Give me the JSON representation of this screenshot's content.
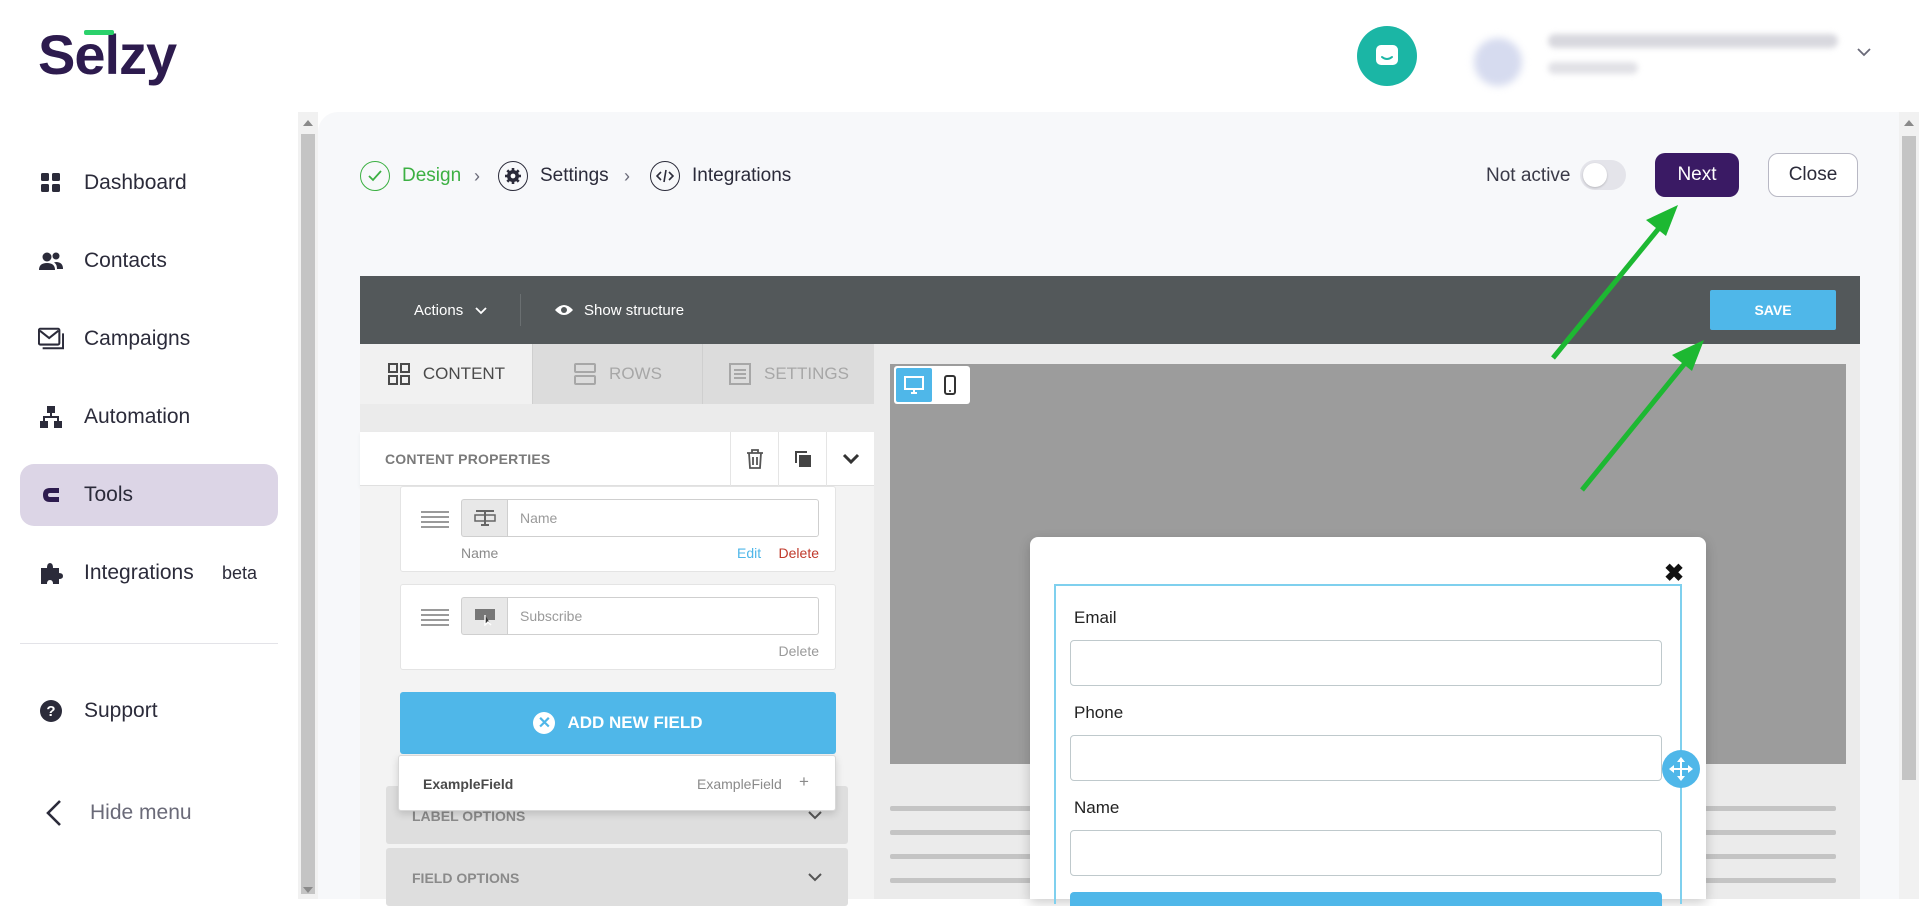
{
  "app": {
    "logo": "Selzy",
    "logo_accent": "#2bd16b",
    "brand_color": "#3a1a64"
  },
  "sidebar": {
    "items": [
      {
        "label": "Dashboard",
        "icon": "dashboard-grid-icon"
      },
      {
        "label": "Contacts",
        "icon": "contacts-people-icon"
      },
      {
        "label": "Campaigns",
        "icon": "campaigns-mail-icon"
      },
      {
        "label": "Automation",
        "icon": "automation-tree-icon"
      },
      {
        "label": "Tools",
        "icon": "tools-magnet-icon",
        "active": true
      },
      {
        "label": "Integrations",
        "icon": "integrations-puzzle-icon",
        "badge": "beta"
      }
    ],
    "support": "Support",
    "hide_menu": "Hide menu"
  },
  "steps": [
    {
      "label": "Design",
      "status": "done"
    },
    {
      "label": "Settings",
      "status": "pending"
    },
    {
      "label": "Integrations",
      "status": "pending"
    }
  ],
  "header": {
    "status_label": "Not active",
    "next_label": "Next",
    "close_label": "Close"
  },
  "editor": {
    "actions_label": "Actions",
    "show_structure_label": "Show structure",
    "save_label": "SAVE",
    "tabs": [
      {
        "label": "CONTENT",
        "active": true
      },
      {
        "label": "ROWS"
      },
      {
        "label": "SETTINGS"
      }
    ],
    "content_properties_title": "CONTENT PROPERTIES",
    "fields": [
      {
        "placeholder": "Name",
        "label": "Name",
        "edit": "Edit",
        "delete": "Delete"
      },
      {
        "placeholder": "Subscribe",
        "delete": "Delete"
      }
    ],
    "add_field_label": "ADD NEW FIELD",
    "dropdown": {
      "name": "ExampleField",
      "value": "ExampleField",
      "plus": "+"
    },
    "options": [
      {
        "label": "LABEL OPTIONS"
      },
      {
        "label": "FIELD OPTIONS"
      }
    ]
  },
  "preview": {
    "close_glyph": "✖",
    "form": [
      {
        "label": "Email"
      },
      {
        "label": "Phone"
      },
      {
        "label": "Name"
      }
    ]
  }
}
